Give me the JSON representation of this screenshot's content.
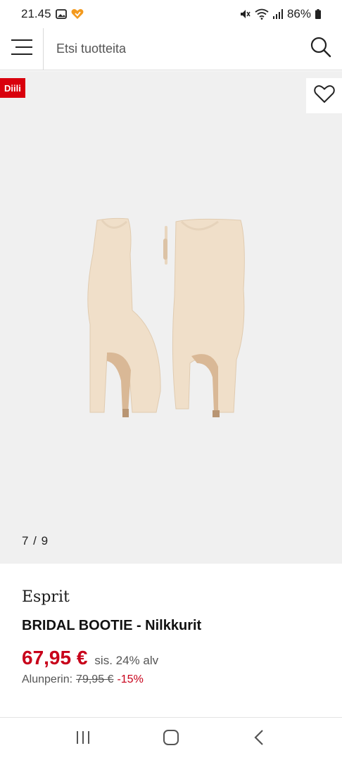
{
  "status_bar": {
    "time": "21.45",
    "battery": "86%"
  },
  "header": {
    "search_placeholder": "Etsi tuotteita"
  },
  "gallery": {
    "deal_badge": "Diili",
    "counter": "7 / 9"
  },
  "product": {
    "brand": "Esprit",
    "name": "BRIDAL BOOTIE - Nilkkurit",
    "price": "67,95 €",
    "vat_note": "sis. 24% alv",
    "original_label": "Alunperin:",
    "original_price": "79,95 €",
    "discount": "-15%"
  },
  "icons": [
    "gallery-icon",
    "heart-badge-icon",
    "mute-icon",
    "wifi-icon",
    "signal-icon",
    "battery-icon",
    "menu-icon",
    "search-icon",
    "wishlist-heart-icon",
    "recent-apps-icon",
    "home-icon",
    "back-icon"
  ],
  "colors": {
    "sale_red": "#c8001a",
    "badge_red": "#d9000d",
    "gallery_bg": "#f0f0f0"
  }
}
